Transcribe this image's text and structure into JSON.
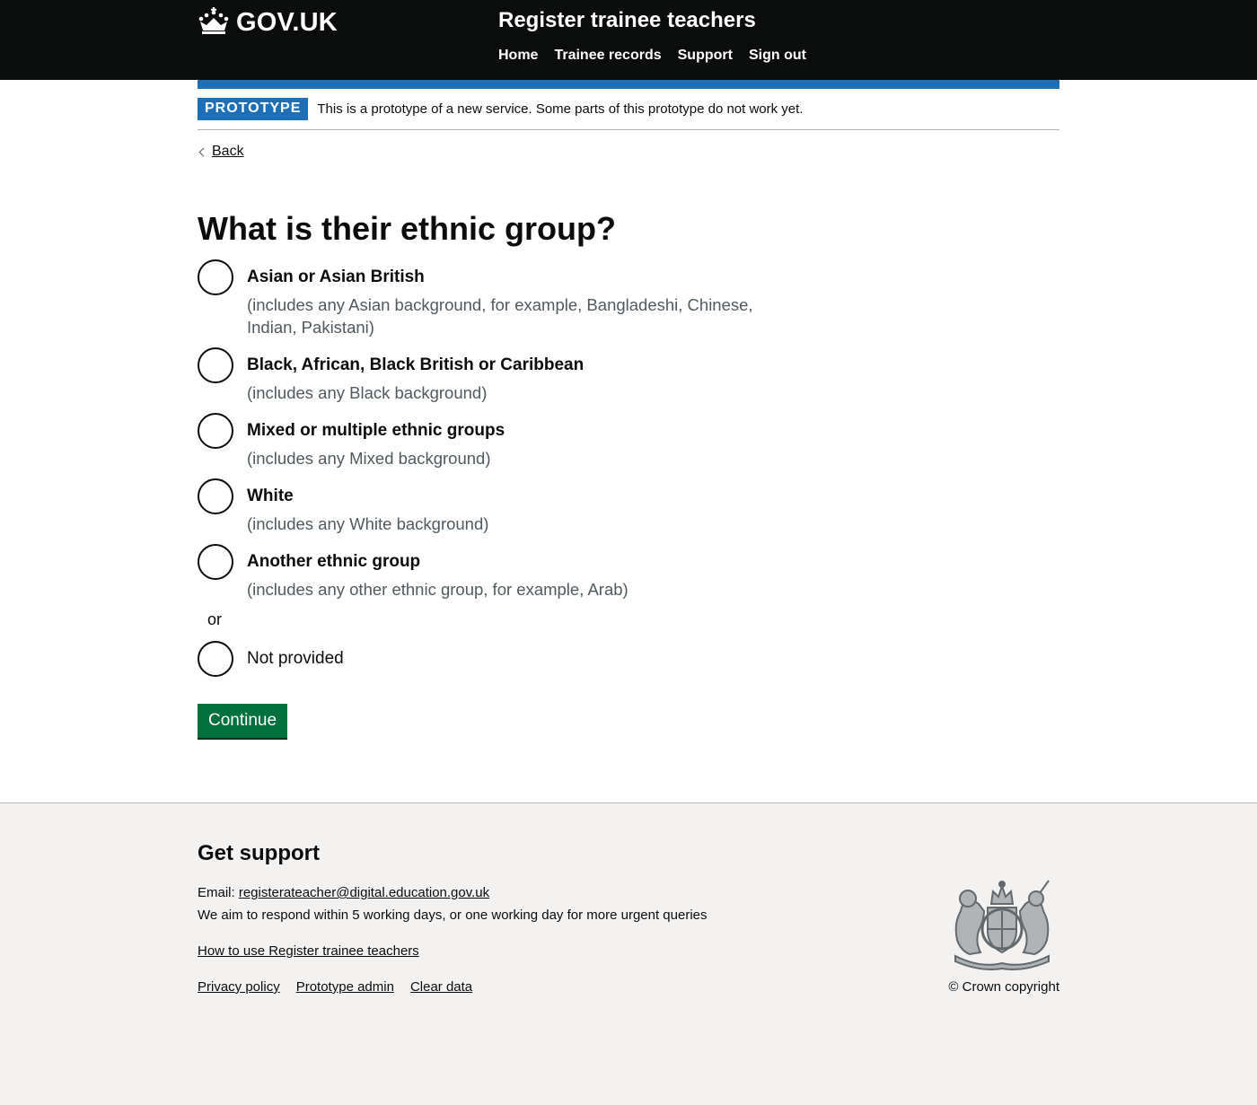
{
  "header": {
    "logo_text": "GOV.UK",
    "service_name": "Register trainee teachers",
    "nav": [
      "Home",
      "Trainee records",
      "Support",
      "Sign out"
    ]
  },
  "phase_banner": {
    "tag": "PROTOTYPE",
    "text": "This is a prototype of a new service. Some parts of this prototype do not work yet."
  },
  "back_link": "Back",
  "question": {
    "title": "What is their ethnic group?",
    "options": [
      {
        "label": "Asian or Asian British",
        "hint": "(includes any Asian background, for example, Bangladeshi, Chinese, Indian, Pakistani)"
      },
      {
        "label": "Black, African, Black British or Caribbean",
        "hint": "(includes any Black background)"
      },
      {
        "label": "Mixed or multiple ethnic groups",
        "hint": "(includes any Mixed background)"
      },
      {
        "label": "White",
        "hint": "(includes any White background)"
      },
      {
        "label": "Another ethnic group",
        "hint": "(includes any other ethnic group, for example, Arab)"
      }
    ],
    "divider": "or",
    "not_provided": "Not provided"
  },
  "continue_label": "Continue",
  "footer": {
    "title": "Get support",
    "email_prefix": "Email: ",
    "email": "registerateacher@digital.education.gov.uk",
    "response_text": "We aim to respond within 5 working days, or one working day for more urgent queries",
    "how_to_link": "How to use Register trainee teachers",
    "links": [
      "Privacy policy",
      "Prototype admin",
      "Clear data"
    ],
    "copyright": "© Crown copyright"
  },
  "colors": {
    "header_bg": "#0b0c0c",
    "brand_blue": "#1d70b8",
    "button_green": "#00703c",
    "footer_bg": "#f3f2f1",
    "hint_grey": "#505a5f"
  },
  "icons": {
    "logo": "crown-icon",
    "back": "chevron-left-icon",
    "footer": "royal-coat-of-arms-icon"
  }
}
